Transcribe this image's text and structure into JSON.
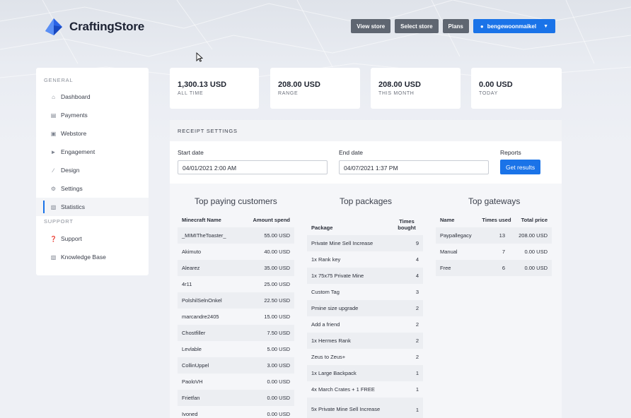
{
  "brand": {
    "name": "CraftingStore"
  },
  "nav": {
    "view_store": "View store",
    "select_store": "Select store",
    "plans": "Plans",
    "user": "bengewoonmaikel"
  },
  "sidebar": {
    "general_heading": "GENERAL",
    "support_heading": "SUPPORT",
    "items": [
      {
        "label": "Dashboard",
        "icon": "home-icon"
      },
      {
        "label": "Payments",
        "icon": "card-icon"
      },
      {
        "label": "Webstore",
        "icon": "basket-icon"
      },
      {
        "label": "Engagement",
        "icon": "megaphone-icon"
      },
      {
        "label": "Design",
        "icon": "brush-icon"
      },
      {
        "label": "Settings",
        "icon": "gears-icon"
      },
      {
        "label": "Statistics",
        "icon": "chart-icon"
      }
    ],
    "support_items": [
      {
        "label": "Support",
        "icon": "question-icon"
      },
      {
        "label": "Knowledge Base",
        "icon": "chart-icon"
      }
    ]
  },
  "stats": [
    {
      "value": "1,300.13 USD",
      "label": "ALL TIME"
    },
    {
      "value": "208.00 USD",
      "label": "RANGE"
    },
    {
      "value": "208.00 USD",
      "label": "THIS MONTH"
    },
    {
      "value": "0.00 USD",
      "label": "TODAY"
    }
  ],
  "receipt": {
    "title": "RECEIPT SETTINGS",
    "start_label": "Start date",
    "start_value": "04/01/2021 2:00 AM",
    "end_label": "End date",
    "end_value": "04/07/2021 1:37 PM",
    "reports_label": "Reports",
    "get_results": "Get results"
  },
  "customers": {
    "title": "Top paying customers",
    "col_name": "Minecraft Name",
    "col_amount": "Amount spend",
    "rows": [
      [
        "_MIMITheToaster_",
        "55.00 USD"
      ],
      [
        "Akimuto",
        "40.00 USD"
      ],
      [
        "Alearez",
        "35.00 USD"
      ],
      [
        "4r11",
        "25.00 USD"
      ],
      [
        "PolshilSelnOnkel",
        "22.50 USD"
      ],
      [
        "marcandre2405",
        "15.00 USD"
      ],
      [
        "Chostfiller",
        "7.50 USD"
      ],
      [
        "Levlable",
        "5.00 USD"
      ],
      [
        "CollinUppel",
        "3.00 USD"
      ],
      [
        "PaoloVH",
        "0.00 USD"
      ],
      [
        "Frietfan",
        "0.00 USD"
      ],
      [
        "Ivoned",
        "0.00 USD"
      ]
    ]
  },
  "packages": {
    "title": "Top packages",
    "col_package": "Package",
    "col_times": "Times bought",
    "rows": [
      [
        "Private Mine Sell Increase",
        "9"
      ],
      [
        "1x Rank key",
        "4"
      ],
      [
        "1x 75x75 Private Mine",
        "4"
      ],
      [
        "Custom Tag",
        "3"
      ],
      [
        "Pmine size upgrade",
        "2"
      ],
      [
        "Add a friend",
        "2"
      ],
      [
        "1x Hermes Rank",
        "2"
      ],
      [
        "Zeus to Zeus+",
        "2"
      ],
      [
        "1x Large Backpack",
        "1"
      ],
      [
        "4x March Crates + 1 FREE",
        "1"
      ],
      [
        "5x Private Mine Sell Increase",
        "1"
      ]
    ]
  },
  "gateways": {
    "title": "Top gateways",
    "col_name": "Name",
    "col_times": "Times used",
    "col_total": "Total price",
    "rows": [
      [
        "Paypallegacy",
        "13",
        "208.00 USD"
      ],
      [
        "Manual",
        "7",
        "0.00 USD"
      ],
      [
        "Free",
        "6",
        "0.00 USD"
      ]
    ]
  },
  "colors": {
    "primary": "#1a73e8",
    "nav_button": "#5f6671"
  }
}
